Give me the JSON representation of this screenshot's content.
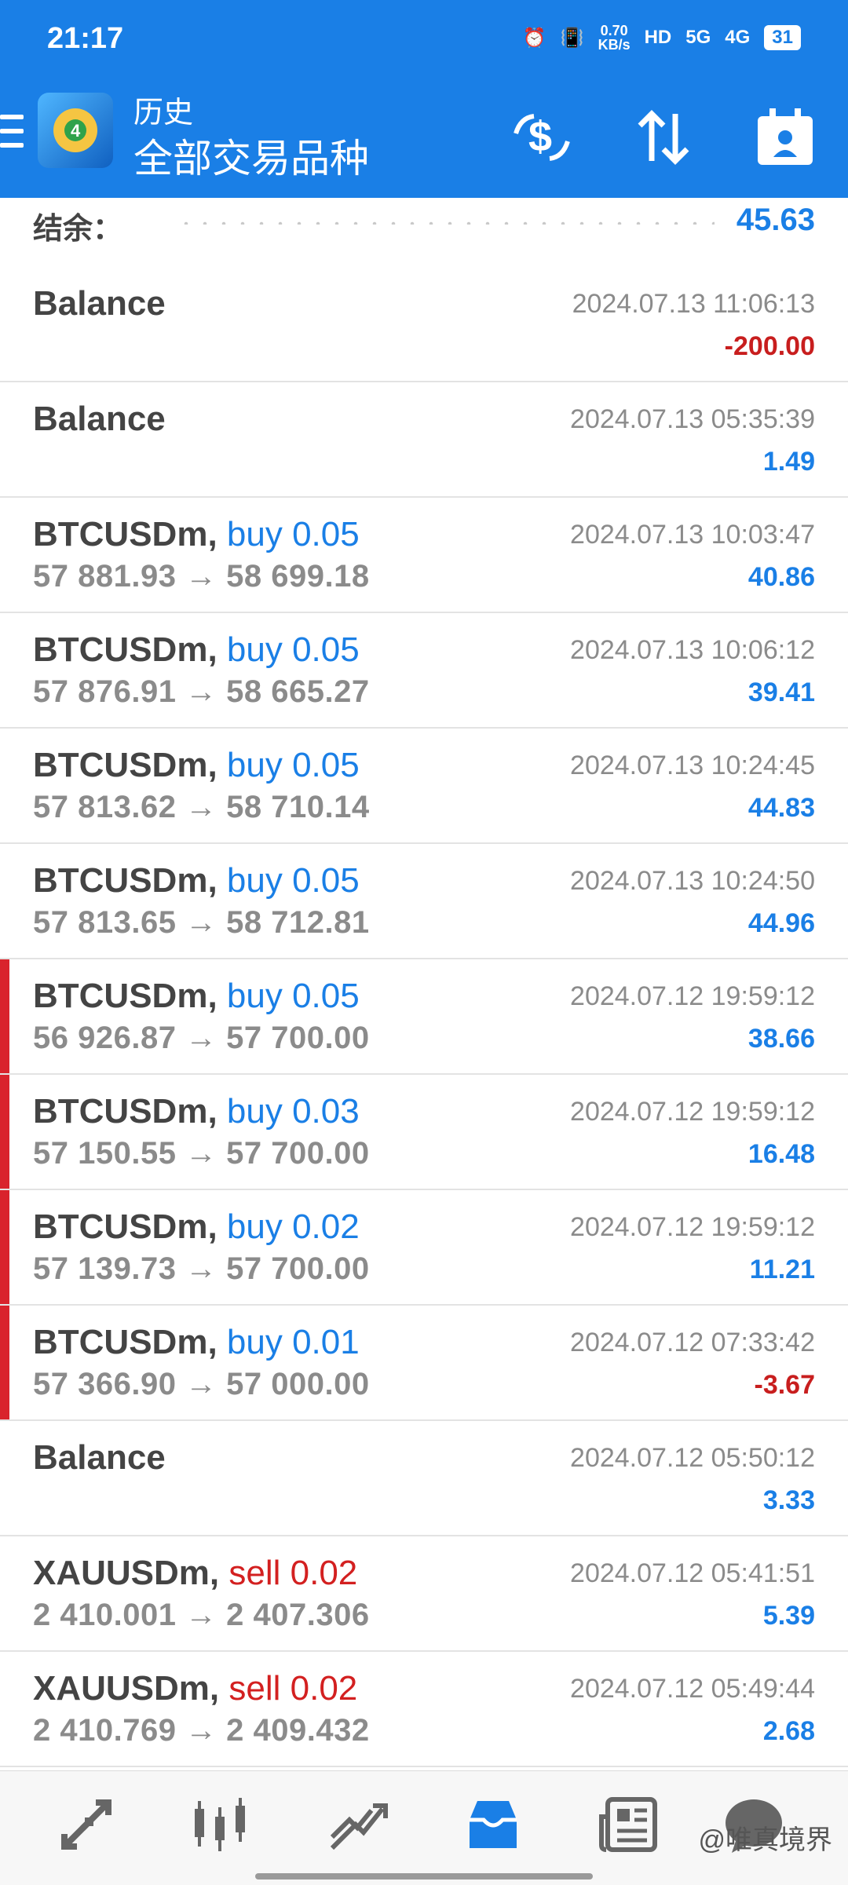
{
  "status_bar": {
    "time": "21:17",
    "network_speed_value": "0.70",
    "network_speed_unit": "KB/s",
    "hd": "HD",
    "sig1": "5G",
    "sig2": "4G",
    "battery": "31"
  },
  "header": {
    "subtitle": "历史",
    "title": "全部交易品种"
  },
  "summary": {
    "label": "结余：",
    "value": "45.63"
  },
  "rows": [
    {
      "symbol": "Balance",
      "direction": "",
      "prices": "",
      "date": "2024.07.13 11:06:13",
      "profit": "-200.00",
      "profit_sign": "neg",
      "marked": false
    },
    {
      "symbol": "Balance",
      "direction": "",
      "prices": "",
      "date": "2024.07.13 05:35:39",
      "profit": "1.49",
      "profit_sign": "pos",
      "marked": false
    },
    {
      "symbol": "BTCUSDm,",
      "direction": "buy 0.05",
      "dir_type": "buy",
      "prices": "57 881.93 → 58 699.18",
      "date": "2024.07.13 10:03:47",
      "profit": "40.86",
      "profit_sign": "pos",
      "marked": false
    },
    {
      "symbol": "BTCUSDm,",
      "direction": "buy 0.05",
      "dir_type": "buy",
      "prices": "57 876.91 → 58 665.27",
      "date": "2024.07.13 10:06:12",
      "profit": "39.41",
      "profit_sign": "pos",
      "marked": false
    },
    {
      "symbol": "BTCUSDm,",
      "direction": "buy 0.05",
      "dir_type": "buy",
      "prices": "57 813.62 → 58 710.14",
      "date": "2024.07.13 10:24:45",
      "profit": "44.83",
      "profit_sign": "pos",
      "marked": false
    },
    {
      "symbol": "BTCUSDm,",
      "direction": "buy 0.05",
      "dir_type": "buy",
      "prices": "57 813.65 → 58 712.81",
      "date": "2024.07.13 10:24:50",
      "profit": "44.96",
      "profit_sign": "pos",
      "marked": false
    },
    {
      "symbol": "BTCUSDm,",
      "direction": "buy 0.05",
      "dir_type": "buy",
      "prices": "56 926.87 → 57 700.00",
      "date": "2024.07.12 19:59:12",
      "profit": "38.66",
      "profit_sign": "pos",
      "marked": true
    },
    {
      "symbol": "BTCUSDm,",
      "direction": "buy 0.03",
      "dir_type": "buy",
      "prices": "57 150.55 → 57 700.00",
      "date": "2024.07.12 19:59:12",
      "profit": "16.48",
      "profit_sign": "pos",
      "marked": true
    },
    {
      "symbol": "BTCUSDm,",
      "direction": "buy 0.02",
      "dir_type": "buy",
      "prices": "57 139.73 → 57 700.00",
      "date": "2024.07.12 19:59:12",
      "profit": "11.21",
      "profit_sign": "pos",
      "marked": true
    },
    {
      "symbol": "BTCUSDm,",
      "direction": "buy 0.01",
      "dir_type": "buy",
      "prices": "57 366.90 → 57 000.00",
      "date": "2024.07.12 07:33:42",
      "profit": "-3.67",
      "profit_sign": "neg",
      "marked": true
    },
    {
      "symbol": "Balance",
      "direction": "",
      "prices": "",
      "date": "2024.07.12 05:50:12",
      "profit": "3.33",
      "profit_sign": "pos",
      "marked": false
    },
    {
      "symbol": "XAUUSDm,",
      "direction": "sell 0.02",
      "dir_type": "sell",
      "prices": "2 410.001 → 2 407.306",
      "date": "2024.07.12 05:41:51",
      "profit": "5.39",
      "profit_sign": "pos",
      "marked": false
    },
    {
      "symbol": "XAUUSDm,",
      "direction": "sell 0.02",
      "dir_type": "sell",
      "prices": "2 410.769 → 2 409.432",
      "date": "2024.07.12 05:49:44",
      "profit": "2.68",
      "profit_sign": "pos",
      "marked": false
    }
  ],
  "bottom_nav": {
    "items": [
      "quotes-icon",
      "chart-icon",
      "trade-icon",
      "history-icon",
      "news-icon",
      "chat-icon"
    ],
    "active": "history-icon"
  },
  "watermark": "@唯真境界",
  "colors": {
    "accent": "#1a7fe6",
    "negative": "#c81e1e",
    "marker": "#d9232c"
  }
}
